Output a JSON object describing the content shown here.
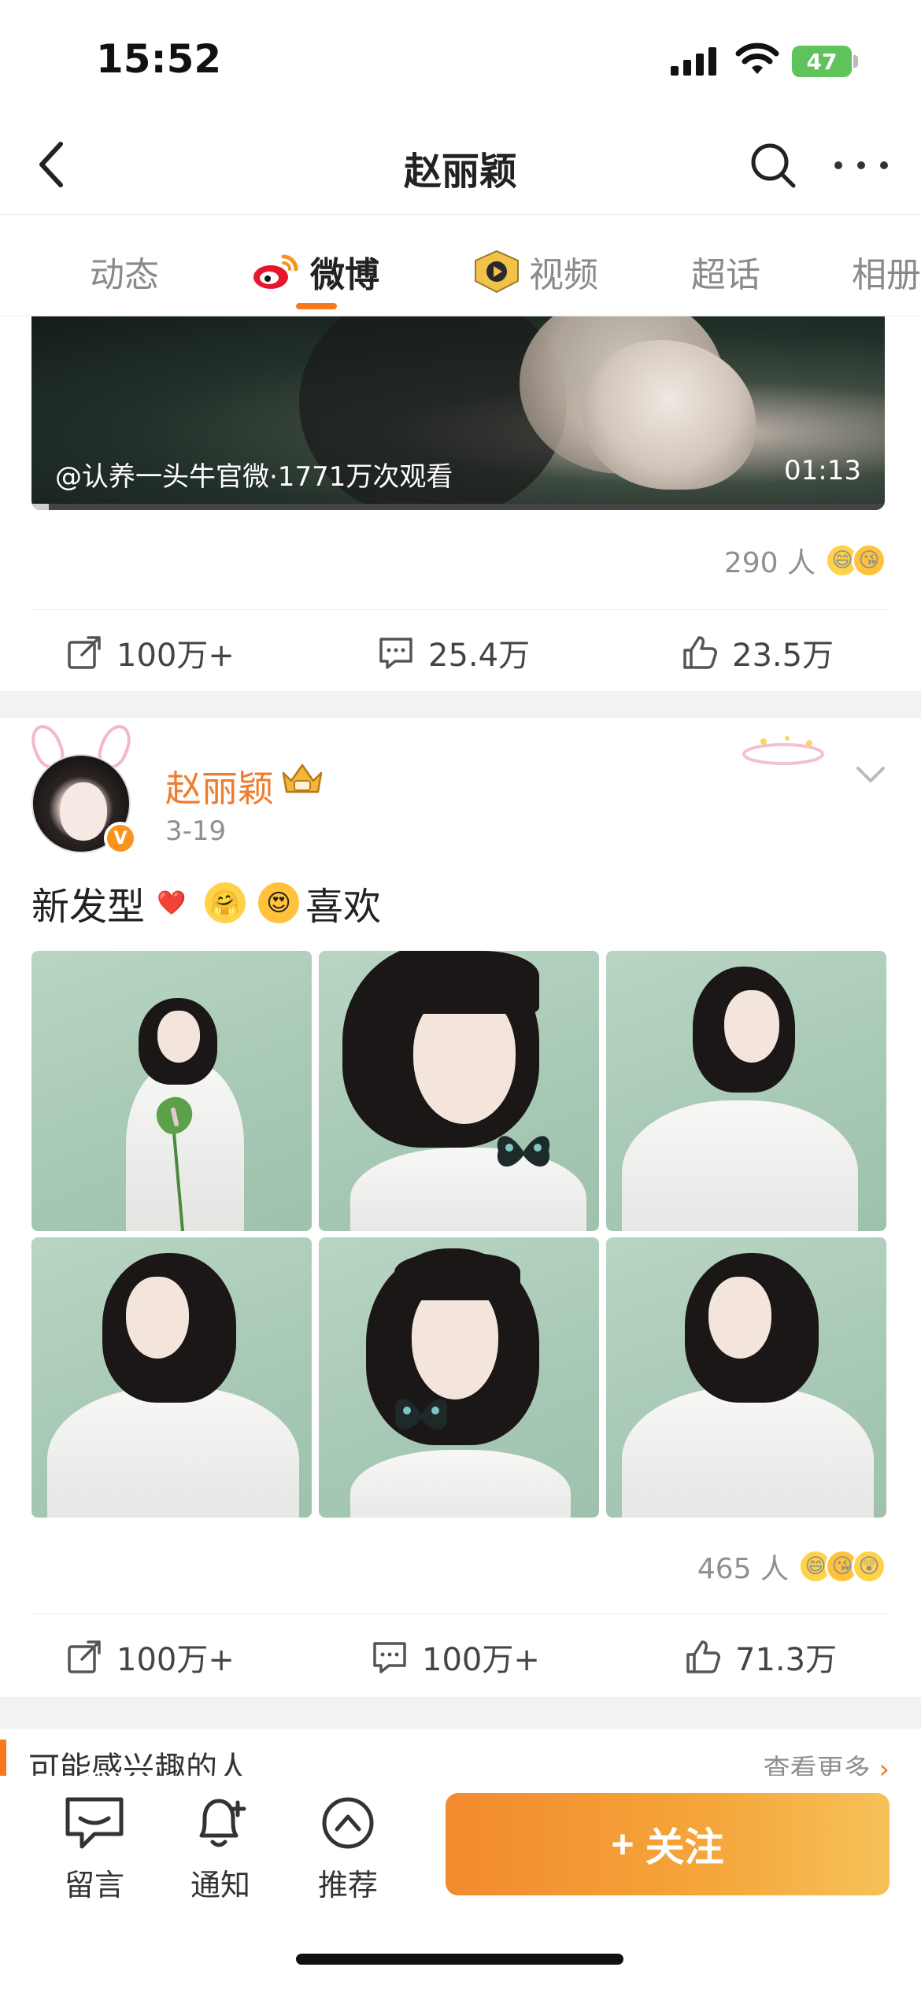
{
  "status_bar": {
    "time": "15:52",
    "battery": "47"
  },
  "nav": {
    "title": "赵丽颖"
  },
  "tabs": [
    {
      "label": "动态",
      "active": false
    },
    {
      "label": "微博",
      "active": true
    },
    {
      "label": "视频",
      "active": false
    },
    {
      "label": "超话",
      "active": false
    },
    {
      "label": "相册",
      "active": false
    }
  ],
  "post1": {
    "video_caption": "@认养一头牛官微·1771万次观看",
    "video_duration": "01:13",
    "video_progress": 0.02,
    "reaction_count": "290 人",
    "reaction_emojis": [
      "😄",
      "😘"
    ],
    "actions": {
      "repost": "100万+",
      "comment": "25.4万",
      "like": "23.5万"
    }
  },
  "post2": {
    "author": "赵丽颖",
    "verified_mark": "V",
    "date": "3-19",
    "text_before": "新发型",
    "text_emojis": [
      "❤️",
      "🤗",
      "😍"
    ],
    "text_after": "喜欢",
    "photo_count": 6,
    "reaction_count": "465 人",
    "reaction_emojis": [
      "😄",
      "😘",
      "😲"
    ],
    "actions": {
      "repost": "100万+",
      "comment": "100万+",
      "like": "71.3万"
    }
  },
  "recommend": {
    "title": "可能感兴趣的人",
    "more": "查看更多",
    "more_arrow": "›"
  },
  "bottom_bar": {
    "message": "留言",
    "notify": "通知",
    "recommend": "推荐",
    "follow_plus": "+",
    "follow": "关注"
  },
  "colors": {
    "accent": "#f7781e",
    "author": "#f07c2a",
    "follow_start": "#f28a2e",
    "follow_end": "#f6c15a"
  },
  "icons": {
    "back": "chevron-left-icon",
    "search": "search-icon",
    "more": "more-dots-icon",
    "repost": "share-icon",
    "comment": "comment-icon",
    "like": "thumbs-up-icon"
  }
}
